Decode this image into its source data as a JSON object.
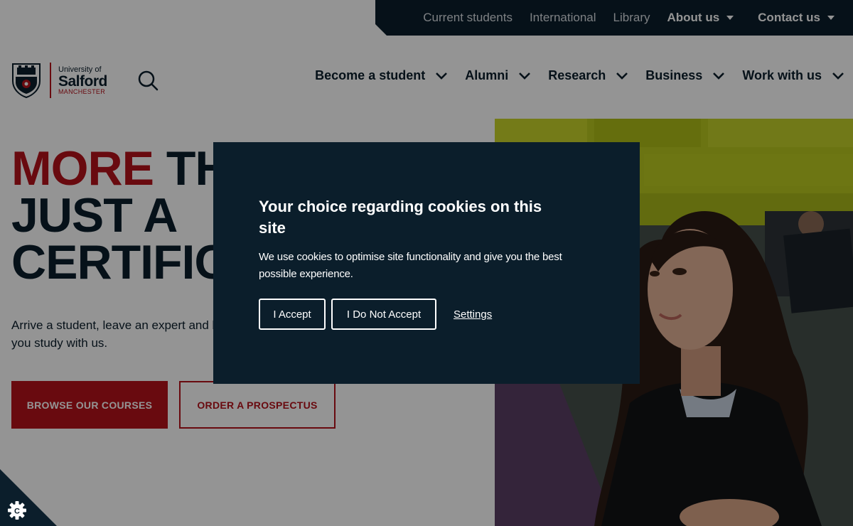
{
  "utility_nav": {
    "items": [
      {
        "label": "Current students"
      },
      {
        "label": "International"
      },
      {
        "label": "Library"
      },
      {
        "label": "About us"
      },
      {
        "label": "Contact us"
      }
    ]
  },
  "logo": {
    "line1": "University of",
    "line2": "Salford",
    "line3": "MANCHESTER"
  },
  "main_nav": {
    "items": [
      {
        "label": "Become a student"
      },
      {
        "label": "Alumni"
      },
      {
        "label": "Research"
      },
      {
        "label": "Business"
      },
      {
        "label": "Work with us"
      }
    ]
  },
  "hero": {
    "title_red": "MORE",
    "title_rest_line1": " THAN",
    "title_line2": "JUST A",
    "title_line3": "CERTIFICATE",
    "subtitle": "Arrive a student, leave an expert and be ready for your future career when you study with us.",
    "primary_button": "BROWSE OUR COURSES",
    "secondary_button": "ORDER A PROSPECTUS"
  },
  "cookie_modal": {
    "title": "Your choice regarding cookies on this site",
    "text": "We use cookies to optimise site functionality and give you the best possible experience.",
    "accept": "I Accept",
    "decline": "I Do Not Accept",
    "settings": "Settings"
  },
  "colors": {
    "navy": "#0b1e2b",
    "brand_red": "#b5121b"
  },
  "icons": {
    "search": "search-icon",
    "cookie_settings": "cookie-gear-icon"
  }
}
